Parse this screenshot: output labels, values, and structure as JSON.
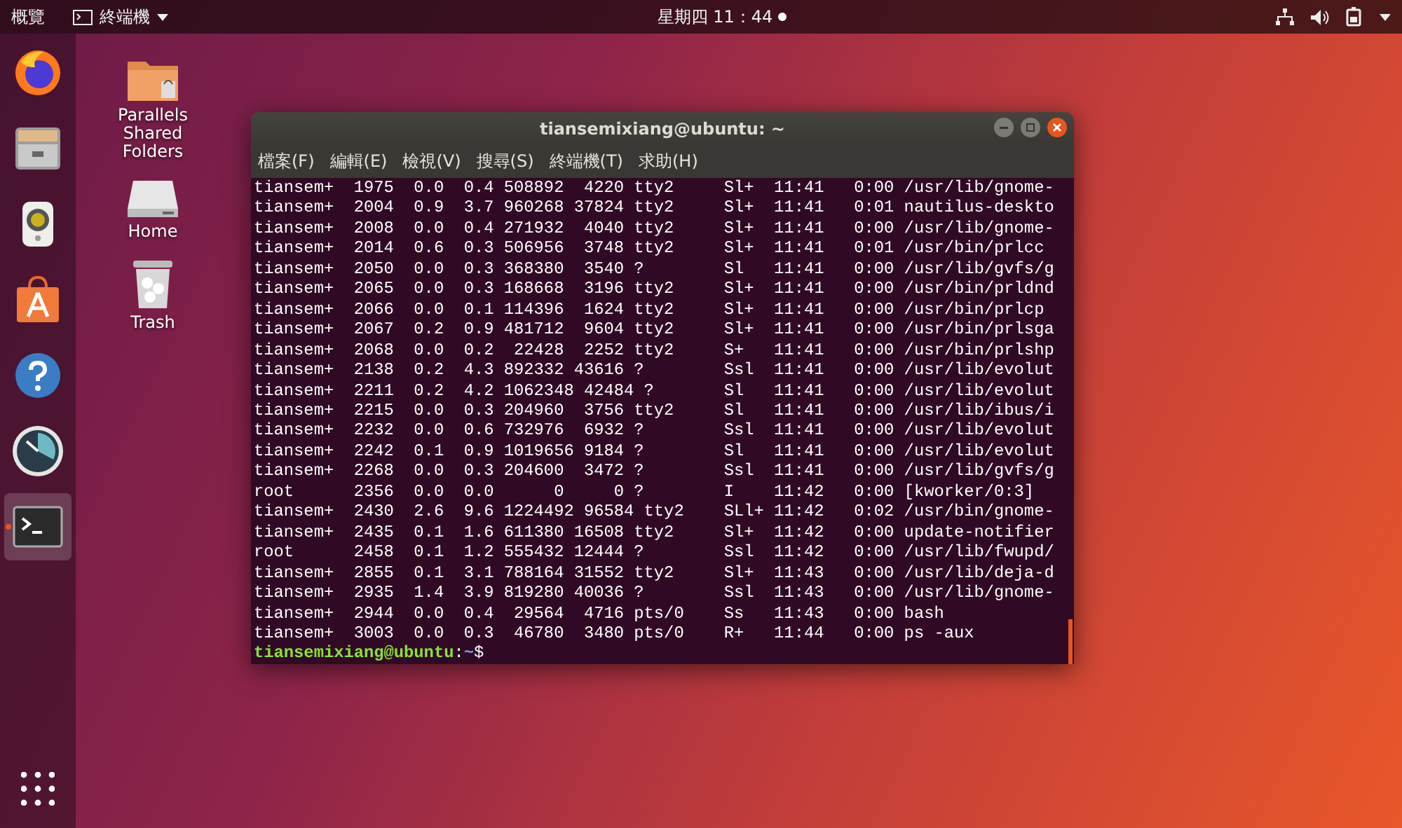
{
  "top_bar": {
    "activities": "概覽",
    "app_menu": "終端機",
    "clock": "星期四 11：44"
  },
  "dock": {
    "items": [
      {
        "kind": "browser",
        "selected": false
      },
      {
        "kind": "files",
        "selected": false
      },
      {
        "kind": "speaker",
        "selected": false
      },
      {
        "kind": "store",
        "selected": false
      },
      {
        "kind": "help",
        "selected": false
      },
      {
        "kind": "gauge",
        "selected": false
      },
      {
        "kind": "terminal",
        "selected": true
      }
    ]
  },
  "desktop_icons": [
    {
      "kind": "folder",
      "label": "Parallels Shared Folders"
    },
    {
      "kind": "drive",
      "label": "Home"
    },
    {
      "kind": "trash",
      "label": "Trash"
    }
  ],
  "terminal": {
    "title": "tiansemixiang@ubuntu: ~",
    "menu": [
      "檔案(F)",
      "編輯(E)",
      "檢視(V)",
      "搜尋(S)",
      "終端機(T)",
      "求助(H)"
    ],
    "lines": [
      "tiansem+  1975  0.0  0.4 508892  4220 tty2     Sl+  11:41   0:00 /usr/lib/gnome-",
      "tiansem+  2004  0.9  3.7 960268 37824 tty2     Sl+  11:41   0:01 nautilus-deskto",
      "tiansem+  2008  0.0  0.4 271932  4040 tty2     Sl+  11:41   0:00 /usr/lib/gnome-",
      "tiansem+  2014  0.6  0.3 506956  3748 tty2     Sl+  11:41   0:01 /usr/bin/prlcc",
      "tiansem+  2050  0.0  0.3 368380  3540 ?        Sl   11:41   0:00 /usr/lib/gvfs/g",
      "tiansem+  2065  0.0  0.3 168668  3196 tty2     Sl+  11:41   0:00 /usr/bin/prldnd",
      "tiansem+  2066  0.0  0.1 114396  1624 tty2     Sl+  11:41   0:00 /usr/bin/prlcp",
      "tiansem+  2067  0.2  0.9 481712  9604 tty2     Sl+  11:41   0:00 /usr/bin/prlsga",
      "tiansem+  2068  0.0  0.2  22428  2252 tty2     S+   11:41   0:00 /usr/bin/prlshp",
      "tiansem+  2138  0.2  4.3 892332 43616 ?        Ssl  11:41   0:00 /usr/lib/evolut",
      "tiansem+  2211  0.2  4.2 1062348 42484 ?       Sl   11:41   0:00 /usr/lib/evolut",
      "tiansem+  2215  0.0  0.3 204960  3756 tty2     Sl   11:41   0:00 /usr/lib/ibus/i",
      "tiansem+  2232  0.0  0.6 732976  6932 ?        Ssl  11:41   0:00 /usr/lib/evolut",
      "tiansem+  2242  0.1  0.9 1019656 9184 ?        Sl   11:41   0:00 /usr/lib/evolut",
      "tiansem+  2268  0.0  0.3 204600  3472 ?        Ssl  11:41   0:00 /usr/lib/gvfs/g",
      "root      2356  0.0  0.0      0     0 ?        I    11:42   0:00 [kworker/0:3]",
      "tiansem+  2430  2.6  9.6 1224492 96584 tty2    SLl+ 11:42   0:02 /usr/bin/gnome-",
      "tiansem+  2435  0.1  1.6 611380 16508 tty2     Sl+  11:42   0:00 update-notifier",
      "root      2458  0.1  1.2 555432 12444 ?        Ssl  11:42   0:00 /usr/lib/fwupd/",
      "tiansem+  2855  0.1  3.1 788164 31552 tty2     Sl+  11:43   0:00 /usr/lib/deja-d",
      "tiansem+  2935  1.4  3.9 819280 40036 ?        Ssl  11:43   0:00 /usr/lib/gnome-",
      "tiansem+  2944  0.0  0.4  29564  4716 pts/0    Ss   11:43   0:00 bash",
      "tiansem+  3003  0.0  0.3  46780  3480 pts/0    R+   11:44   0:00 ps -aux"
    ],
    "prompt": {
      "user_host": "tiansemixiang@ubuntu",
      "separator": ":",
      "path": "~",
      "symbol": "$"
    }
  }
}
